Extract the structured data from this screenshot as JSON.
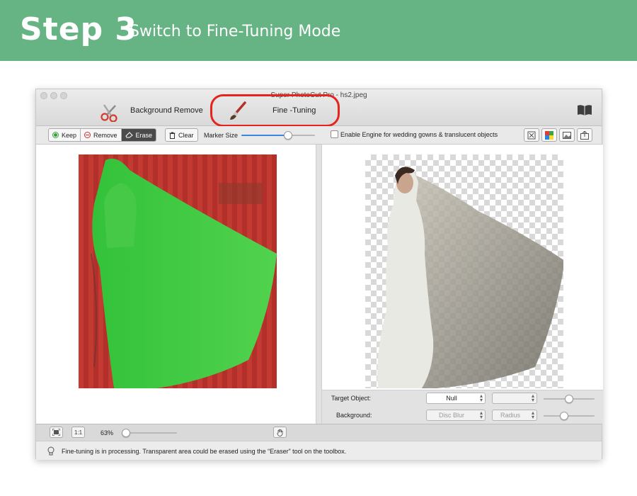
{
  "banner": {
    "step": "Step 3",
    "subtitle": "Switch to Fine-Tuning Mode",
    "color": "#66b384"
  },
  "window": {
    "title": "Super PhotoCut Pro - hs2.jpeg",
    "modes": {
      "background_remove": "Background Remove",
      "fine_tuning": "Fine -Tuning",
      "highlight_color": "#e5231f"
    },
    "help_icon": "book-icon"
  },
  "toolbar": {
    "keep": "Keep",
    "remove": "Remove",
    "erase": "Erase",
    "clear": "Clear",
    "marker_size_label": "Marker Size",
    "marker_size_value": 0.63,
    "engine_checkbox_label": "Enable Engine for wedding gowns & translucent objects",
    "engine_checked": false,
    "view_icons": [
      "fit-view-icon",
      "color-mode-icon",
      "image-view-icon",
      "export-icon"
    ]
  },
  "options": {
    "target_object_label": "Target Object:",
    "target_object_value": "Null",
    "background_label": "Background:",
    "background_value": "Disc Blur",
    "radius_label": "Radius",
    "target_slider_value": 0.5,
    "background_slider_value": 0.4
  },
  "bottombar": {
    "fit_icon": "fit-screen-icon",
    "one_to_one": "1:1",
    "zoom": "63%",
    "zoom_value": 0.08,
    "hand_icon": "hand-icon"
  },
  "status": {
    "text": "Fine-tuning is in processing. Transparent area could be erased using the “Eraser” tool on the toolbox."
  }
}
